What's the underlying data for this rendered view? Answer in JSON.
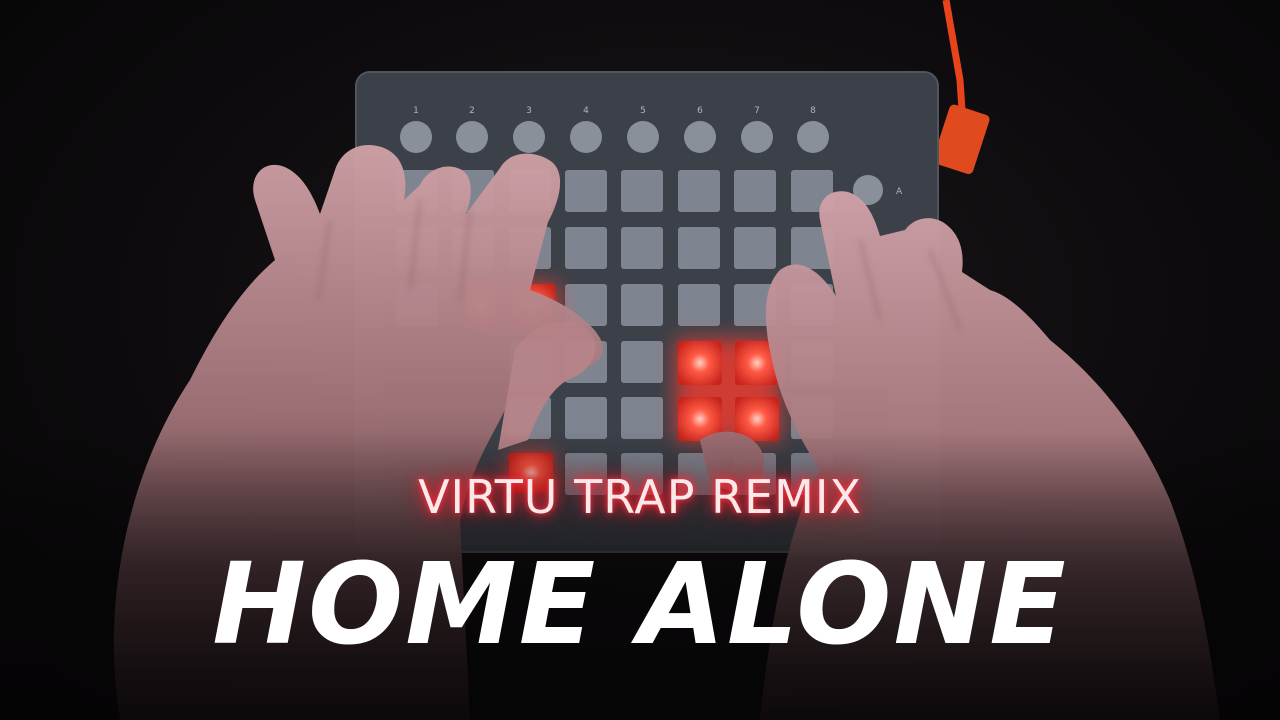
{
  "video": {
    "subtitle": "VIRTU TRAP REMIX",
    "title": "HOME ALONE"
  },
  "controller": {
    "column_labels": [
      "1",
      "2",
      "3",
      "4",
      "5",
      "6",
      "7",
      "8"
    ],
    "side_button_label": "A",
    "lit_color": "#ff3b2f",
    "pad_color": "#7f8590",
    "body_color": "#3c4149",
    "cable_color": "#e8441c"
  }
}
